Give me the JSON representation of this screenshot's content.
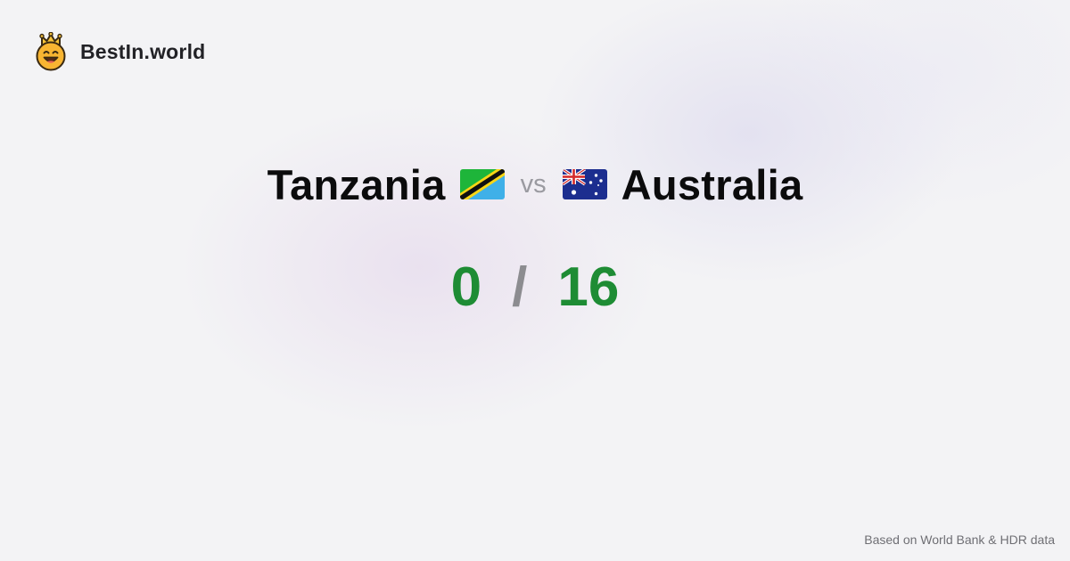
{
  "brand": {
    "name": "BestIn.world",
    "icon": "crowned-smiley-icon"
  },
  "comparison": {
    "left_country": "Tanzania",
    "left_flag": "tanzania-flag-icon",
    "vs_label": "vs",
    "right_country": "Australia",
    "right_flag": "australia-flag-icon"
  },
  "score": {
    "left": "0",
    "separator": "/",
    "right": "16"
  },
  "footer": {
    "source": "Based on World Bank & HDR data"
  },
  "colors": {
    "score_green": "#1e8c34",
    "separator_gray": "#8c8c90",
    "vs_gray": "#9a9aa0",
    "brand_gold": "#f5b82e"
  }
}
